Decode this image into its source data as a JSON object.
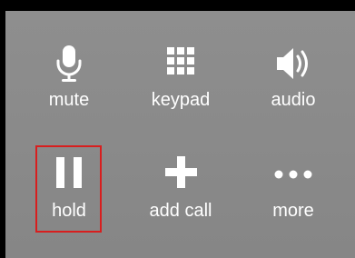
{
  "call_controls": {
    "buttons": [
      {
        "label": "mute",
        "icon": "microphone-icon"
      },
      {
        "label": "keypad",
        "icon": "keypad-grid-icon"
      },
      {
        "label": "audio",
        "icon": "speaker-icon"
      },
      {
        "label": "hold",
        "icon": "pause-icon"
      },
      {
        "label": "add call",
        "icon": "plus-icon"
      },
      {
        "label": "more",
        "icon": "ellipsis-icon"
      }
    ],
    "highlighted_button": "hold",
    "colors": {
      "panel_background": "#8a8a8a",
      "icon_and_text": "#ffffff",
      "highlight_border": "#d81e1e",
      "frame": "#000000"
    }
  }
}
